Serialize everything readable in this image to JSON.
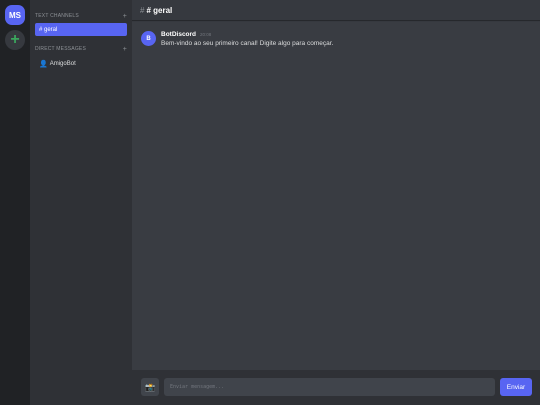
{
  "servers": {
    "current_initials": "MS",
    "add_glyph": "+"
  },
  "sidebar": {
    "text_channels_header": "TEXT CHANNELS",
    "dm_header": "DIRECT MESSAGES",
    "add_glyph": "+",
    "channels": [
      {
        "label": "# geral"
      }
    ],
    "dms": [
      {
        "label": "AmigoBot",
        "icon": "person-icon"
      }
    ]
  },
  "header": {
    "hash": "#",
    "title": "# geral"
  },
  "messages": [
    {
      "avatar": "B",
      "author": "BotDiscord",
      "time": "20:08",
      "text": "Bem-vindo ao seu primeiro canal! Digite algo para começar."
    }
  ],
  "composer": {
    "attach_icon": "camera-icon",
    "placeholder": "Enviar mensagem...",
    "value": "",
    "send_label": "Enviar"
  },
  "colors": {
    "accent": "#5865f2",
    "rail_bg": "#202225",
    "sidebar_bg": "#2f3136",
    "main_bg": "#36393f",
    "add_green": "#3ba55d"
  }
}
